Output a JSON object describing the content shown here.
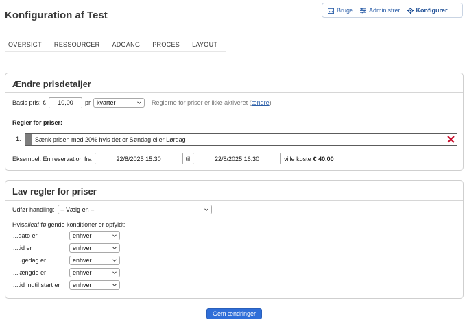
{
  "page": {
    "title": "Konfiguration af Test"
  },
  "topnav": {
    "items": [
      {
        "label": "Bruge",
        "icon": "calendar-icon"
      },
      {
        "label": "Administrer",
        "icon": "sliders-icon"
      },
      {
        "label": "Konfigurer",
        "icon": "gear-icon",
        "active": true
      }
    ]
  },
  "tabs": [
    "OVERSIGT",
    "RESSOURCER",
    "ADGANG",
    "PROCES",
    "LAYOUT"
  ],
  "pricing": {
    "title": "Ændre prisdetaljer",
    "base_label": "Basis pris: €",
    "base_value": "10,00",
    "per_label": "pr",
    "per_unit": "kvarter",
    "rules_status": "Reglerne for priser er ikke aktiveret (",
    "rules_link": "ændre",
    "rules_status_end": ")",
    "rules_heading": "Regler for priser:",
    "rules": [
      {
        "number": "1.",
        "text": "Sænk prisen med 20% hvis det er Søndag eller Lørdag"
      }
    ],
    "example_label": "Eksempel: En reservation fra",
    "example_from": "22/8/2025 15:30",
    "example_to_label": "til",
    "example_to": "22/8/2025 16:30",
    "example_cost_label": "ville koste",
    "example_cost": "€ 40,00"
  },
  "make_rules": {
    "title": "Lav regler for priser",
    "action_label": "Udfør handling:",
    "action_value": "– Vælg en –",
    "conditions_intro_pre": "Hvis ",
    "conditions_intro_em": "alle",
    "conditions_intro_post": " af følgende konditioner er opfyldt:",
    "conditions": [
      {
        "label": "...dato er",
        "value": "enhver"
      },
      {
        "label": "...tid er",
        "value": "enhver"
      },
      {
        "label": "...ugedag er",
        "value": "enhver"
      },
      {
        "label": "...længde er",
        "value": "enhver"
      },
      {
        "label": "...tid indtil start er",
        "value": "enhver"
      }
    ]
  },
  "save_label": "Gem ændringer",
  "colors": {
    "accent": "#2f6ed8",
    "link": "#2b5ea8",
    "delete": "#c8102e"
  }
}
